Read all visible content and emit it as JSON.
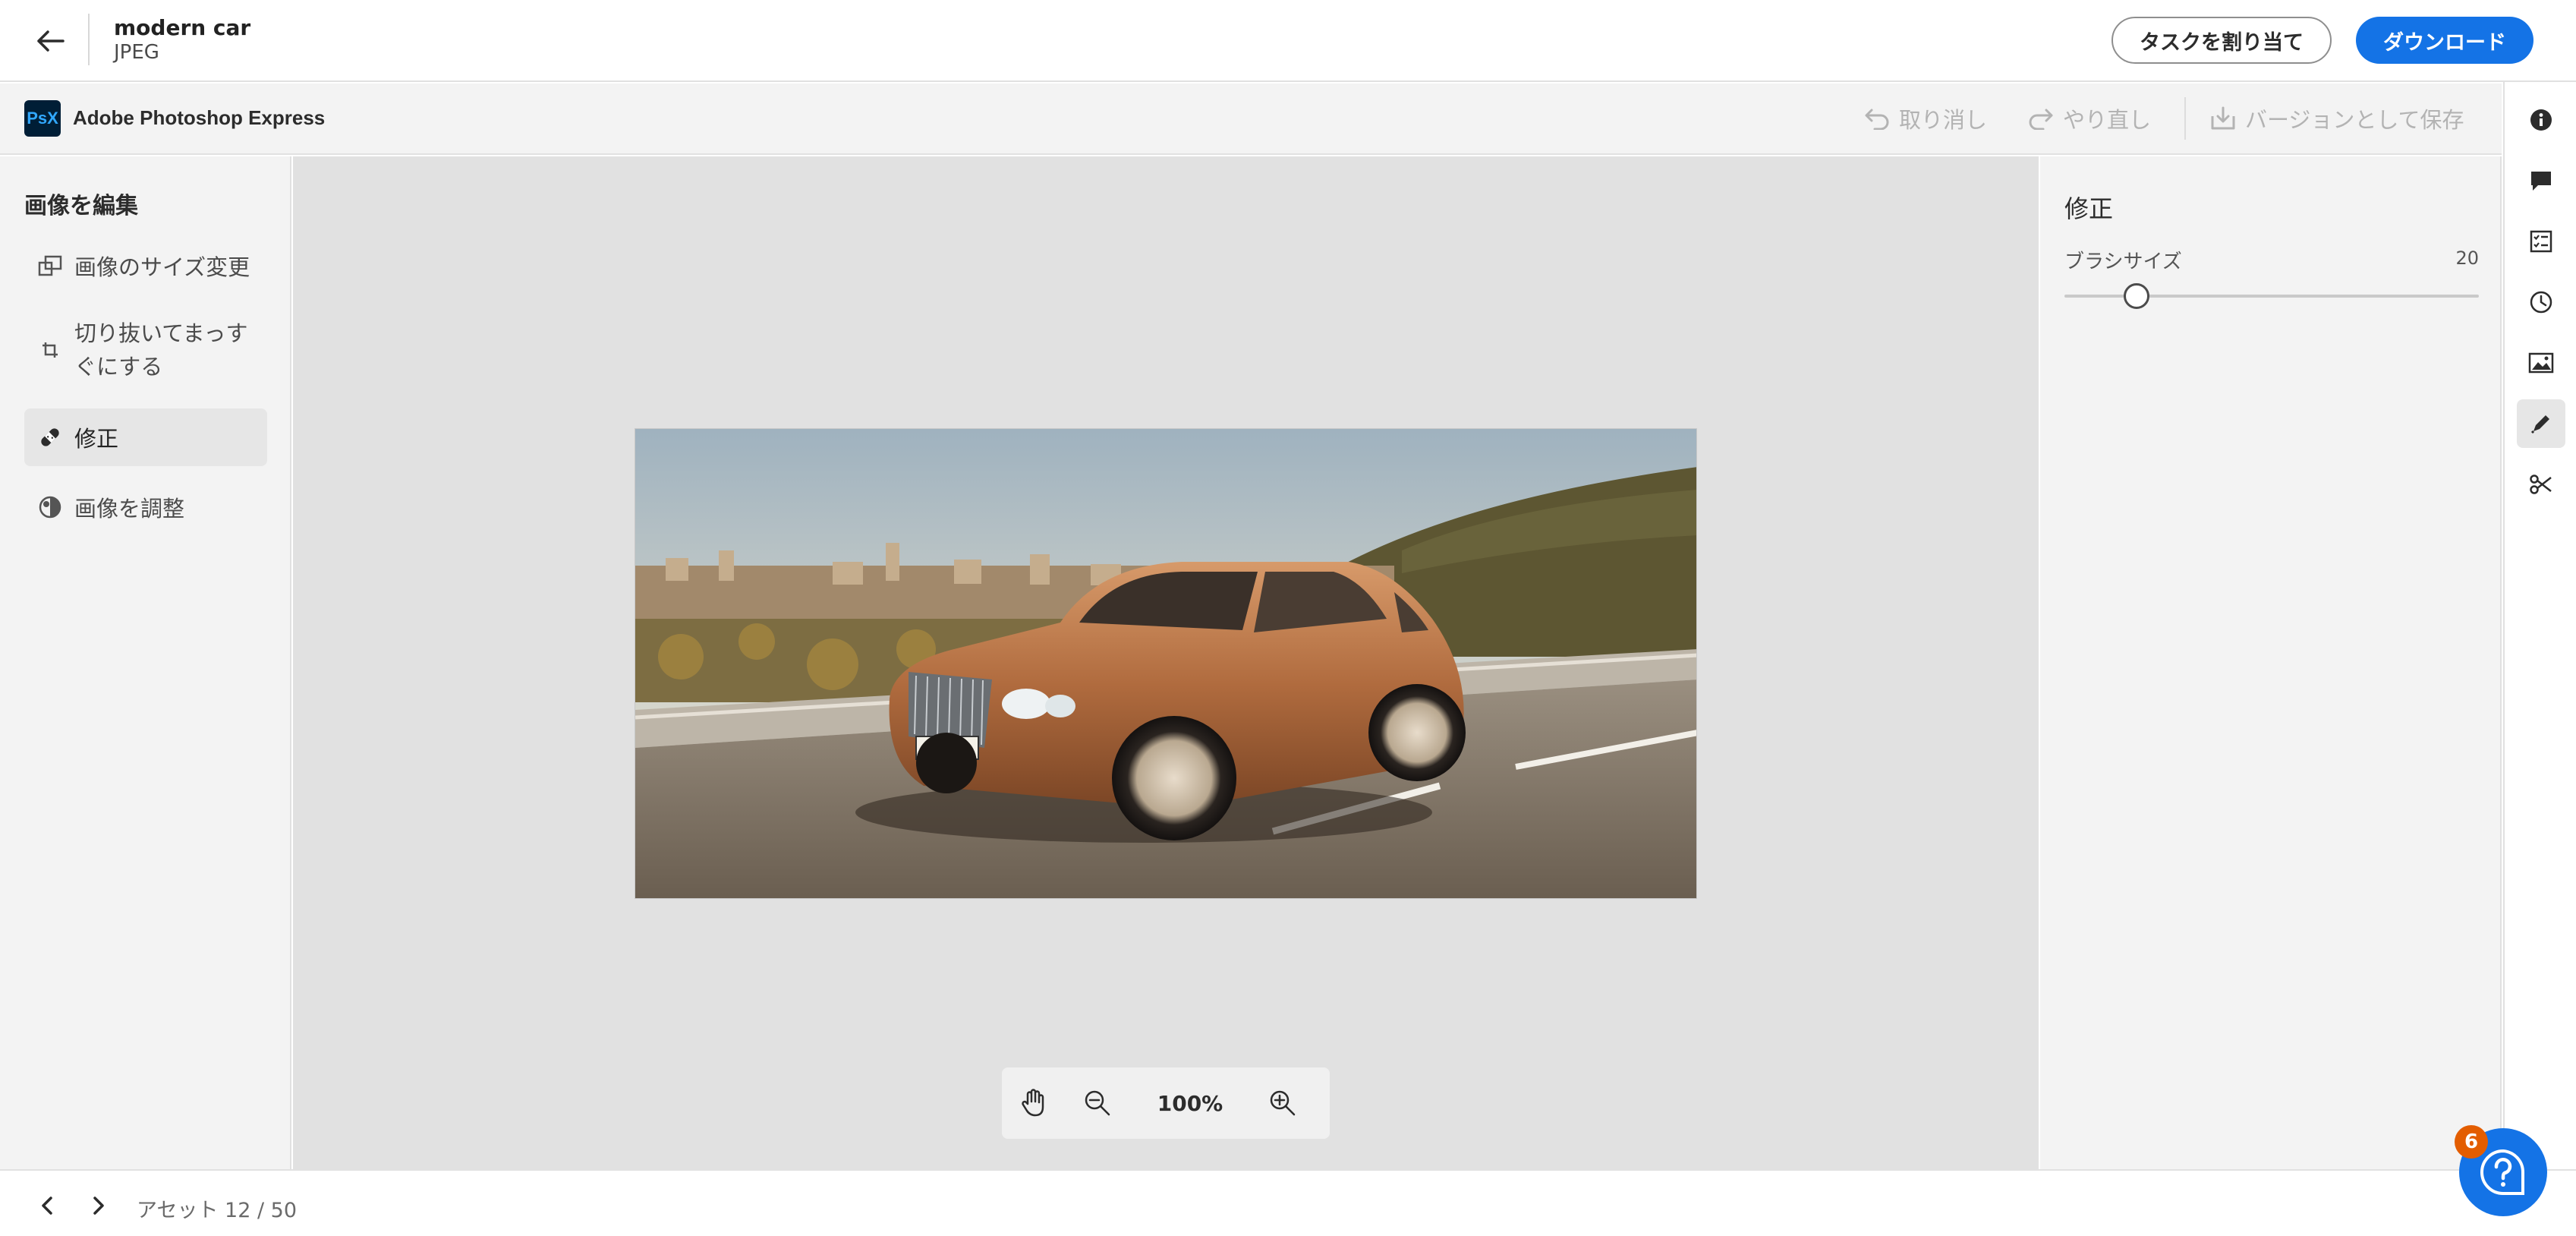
{
  "header": {
    "title": "modern car",
    "file_type": "JPEG",
    "assign_task_label": "タスクを割り当て",
    "download_label": "ダウンロード",
    "back_icon": "arrow-left-icon"
  },
  "toolbar": {
    "app_logo_text": "PsX",
    "app_name": "Adobe Photoshop Express",
    "undo_label": "取り消し",
    "redo_label": "やり直し",
    "save_version_label": "バージョンとして保存"
  },
  "left_panel": {
    "heading": "画像を編集",
    "items": [
      {
        "label": "画像のサイズ変更",
        "icon": "resize-icon"
      },
      {
        "label": "切り抜いてまっすぐにする",
        "icon": "crop-icon"
      },
      {
        "label": "修正",
        "icon": "healing-brush-icon",
        "active": true
      },
      {
        "label": "画像を調整",
        "icon": "adjust-icon"
      }
    ]
  },
  "canvas": {
    "zoom_label": "100%"
  },
  "right_panel": {
    "title": "修正",
    "brush_size_label": "ブラシサイズ",
    "brush_size_value": "20"
  },
  "rail": {
    "items": [
      "info-icon",
      "comment-icon",
      "tasks-icon",
      "history-icon",
      "image-icon",
      "edit-brush-icon",
      "cut-icon"
    ],
    "active": "edit-brush-icon"
  },
  "footer": {
    "asset_counter": "アセット 12 / 50"
  },
  "help": {
    "badge_count": "6"
  },
  "colors": {
    "accent": "#1473e6",
    "badge": "#e35d00",
    "panel_bg": "#f3f3f3",
    "canvas_bg": "#e1e1e1"
  }
}
